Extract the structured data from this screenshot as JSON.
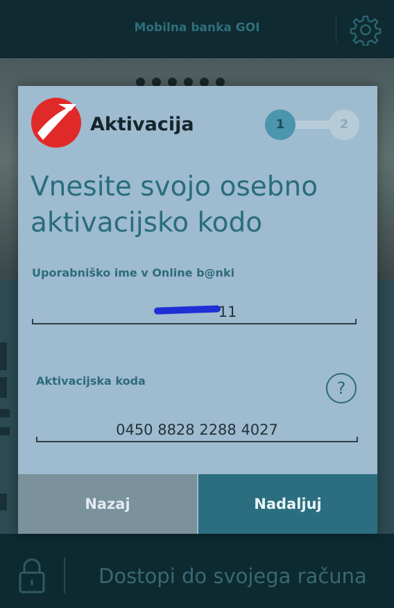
{
  "app": {
    "title": "Mobilna banka GOI"
  },
  "modal": {
    "title": "Aktivacija",
    "steps": [
      "1",
      "2"
    ],
    "heading": "Vnesite svojo osebno aktivacijsko kodo",
    "username_label": "Uporabniško ime v Online b@nki",
    "username_value": "11",
    "code_label": "Aktivacijska koda",
    "code_value": "0450 8828 2288 4027",
    "help_symbol": "?",
    "back_label": "Nazaj",
    "next_label": "Nadaljuj"
  },
  "bottom_bar": {
    "text": "Dostopi do svojega računa"
  },
  "icons": {
    "settings": "gear-icon",
    "lock": "lock-icon",
    "help": "question-circle-icon",
    "logo": "bank-logo-icon"
  },
  "colors": {
    "modal_bg": "#9ebbcf",
    "accent": "#2b6e80",
    "brand_red": "#e02a2a",
    "step_active": "#4b95ae"
  }
}
